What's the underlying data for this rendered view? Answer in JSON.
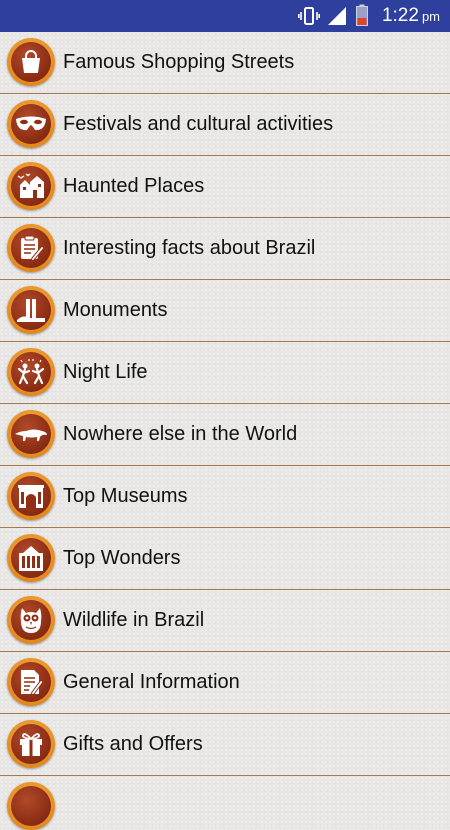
{
  "status_bar": {
    "time": "1:22",
    "ampm": "pm",
    "icons": [
      "vibrate-icon",
      "signal-icon",
      "battery-icon"
    ],
    "background_color": "#2f3f9e"
  },
  "menu": {
    "items": [
      {
        "label": "Famous Shopping Streets",
        "icon": "shopping-bag-icon"
      },
      {
        "label": "Festivals and cultural activities",
        "icon": "carnival-mask-icon"
      },
      {
        "label": "Haunted Places",
        "icon": "haunted-house-icon"
      },
      {
        "label": "Interesting facts about Brazil",
        "icon": "notepad-pencil-icon"
      },
      {
        "label": "Monuments",
        "icon": "monument-icon"
      },
      {
        "label": "Night Life",
        "icon": "dancers-icon"
      },
      {
        "label": "Nowhere else in the World",
        "icon": "anteater-icon"
      },
      {
        "label": "Top Museums",
        "icon": "museum-icon"
      },
      {
        "label": "Top Wonders",
        "icon": "palace-icon"
      },
      {
        "label": "Wildlife in Brazil",
        "icon": "owl-icon"
      },
      {
        "label": "General Information",
        "icon": "document-pencil-icon"
      },
      {
        "label": "Gifts and Offers",
        "icon": "gift-icon"
      }
    ],
    "separator_color": "#a57a4a",
    "badge_outer_color": "#e48a1f",
    "badge_inner_color": "#8f2f16"
  }
}
